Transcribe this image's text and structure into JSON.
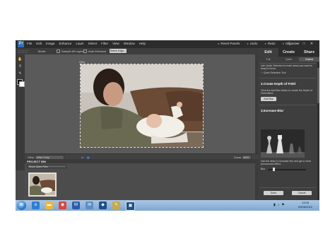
{
  "menubar": {
    "logo": "Pr",
    "items": [
      "File",
      "Edit",
      "Image",
      "Enhance",
      "Layer",
      "Select",
      "Filter",
      "View",
      "Window",
      "Help"
    ],
    "right": [
      "Reset Panels",
      "Undo",
      "Redo",
      "Organizer"
    ]
  },
  "options": {
    "mode_label": "Mode:",
    "sample_all": "Sample All Layers",
    "auto_enhance": "Auto Enhance",
    "refine_edge": "Refine Edge..."
  },
  "canvas": {
    "doc_title": "After"
  },
  "status": {
    "view_label": "View:",
    "view_value": "After Only",
    "zoom_label": "Zoom:",
    "zoom_value": "34%"
  },
  "bin": {
    "header": "PROJECT BIN",
    "dropdown": "Show Open Files"
  },
  "panel": {
    "tabs": [
      "Edit",
      "Create",
      "Share"
    ],
    "modes": [
      "Full",
      "Quick",
      "Guided"
    ],
    "intro": "Use Quick Selection to mark areas you want to keep in focus.",
    "quick_selection": "Quick Selection Tool",
    "step2_title": "2.Create Depth of Field",
    "step2_text": "Click the Add Blur button to create the Depth of Field effect.",
    "add_blur": "Add Blur",
    "step3_title": "3.Increase Blur",
    "step3_text": "Use the slider to increase blur and get a more pronounced effect.",
    "blur_label": "Blur",
    "done": "Done",
    "cancel": "Cancel"
  },
  "taskbar": {
    "icons": [
      "ie-icon",
      "folder-icon",
      "chrome-icon",
      "word-icon",
      "mail-icon",
      "photoshop-icon",
      "paint-icon",
      "app-icon"
    ],
    "time": "13:05",
    "date": "09/06/2012"
  },
  "colors": {
    "accent": "#2f6fb5",
    "app_bg": "#4a4a4a",
    "panel_bg": "#3e3e3e"
  }
}
